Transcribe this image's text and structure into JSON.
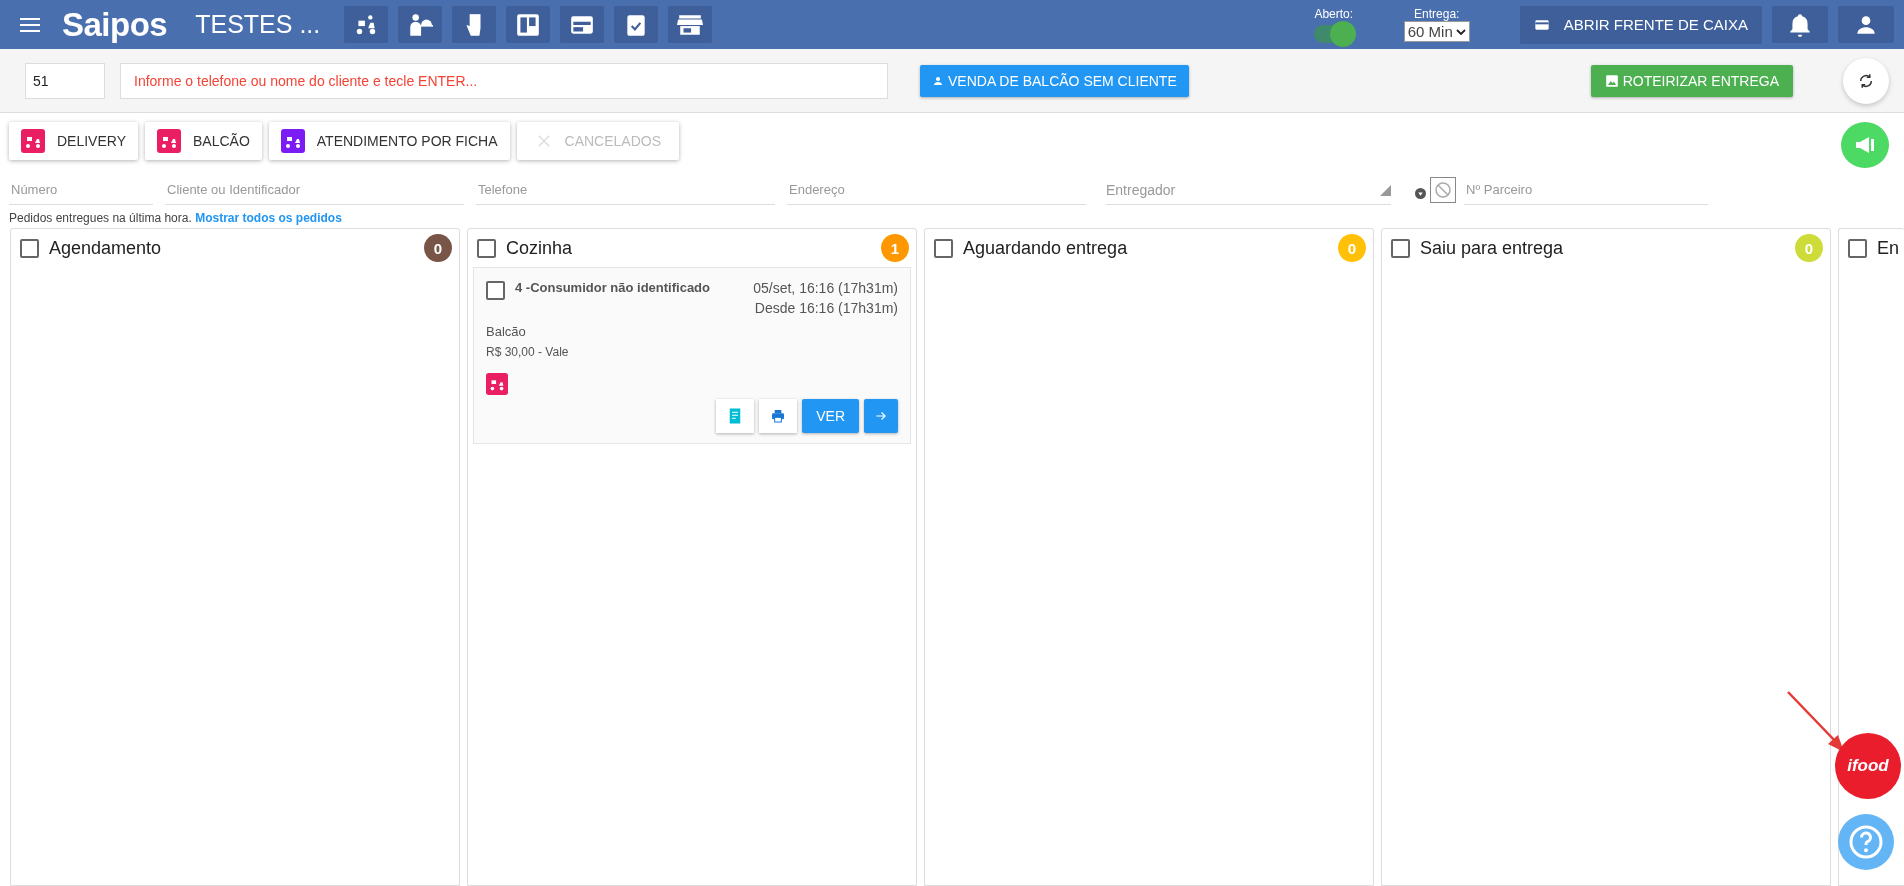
{
  "header": {
    "brand": "Saipos",
    "store": "TESTES ...",
    "open_label": "Aberto:",
    "open_on": true,
    "delivery_label": "Entrega:",
    "delivery_time": "60 Min",
    "cash_button": "ABRIR FRENTE DE CAIXA"
  },
  "toolbar": {
    "number": "51",
    "search_placeholder": "Informe o telefone ou nome do cliente e tecle ENTER...",
    "counter_sale_button": "VENDA DE BALCÃO SEM CLIENTE",
    "route_button": "ROTEIRIZAR ENTREGA"
  },
  "order_types": [
    {
      "label": "DELIVERY",
      "kind": "delivery",
      "disabled": false
    },
    {
      "label": "BALCÃO",
      "kind": "counter",
      "disabled": false
    },
    {
      "label": "ATENDIMENTO POR FICHA",
      "kind": "ticket",
      "disabled": false
    },
    {
      "label": "CANCELADOS",
      "kind": "cancel",
      "disabled": true
    }
  ],
  "filters": [
    {
      "placeholder": "Número",
      "kind": "text"
    },
    {
      "placeholder": "Cliente ou Identificador",
      "kind": "text"
    },
    {
      "placeholder": "Telefone",
      "kind": "text"
    },
    {
      "placeholder": "Endereço",
      "kind": "text"
    },
    {
      "placeholder": "Entregador",
      "kind": "select"
    },
    {
      "placeholder": "Nº Parceiro",
      "kind": "partner"
    }
  ],
  "info": {
    "text": "Pedidos entregues na última hora.",
    "link": "Mostrar todos os pedidos"
  },
  "columns": [
    {
      "title": "Agendamento",
      "count": "0",
      "color": "#795548",
      "checked": false
    },
    {
      "title": "Cozinha",
      "count": "1",
      "color": "#ff9800",
      "checked": false,
      "orders": [
        {
          "name": "4 -Consumidor não identificado",
          "date": "05/set, 16:16 (17h31m)",
          "since": "Desde 16:16 (17h31m)",
          "type": "Balcão",
          "price": "R$ 30,00 - Vale",
          "checked": false,
          "view_button": "VER"
        }
      ]
    },
    {
      "title": "Aguardando entrega",
      "count": "0",
      "color": "#ffc107",
      "checked": false
    },
    {
      "title": "Saiu para entrega",
      "count": "0",
      "color": "#cddc39",
      "checked": false
    },
    {
      "title": "En",
      "checked": false
    }
  ],
  "ifood_button": "ifood"
}
